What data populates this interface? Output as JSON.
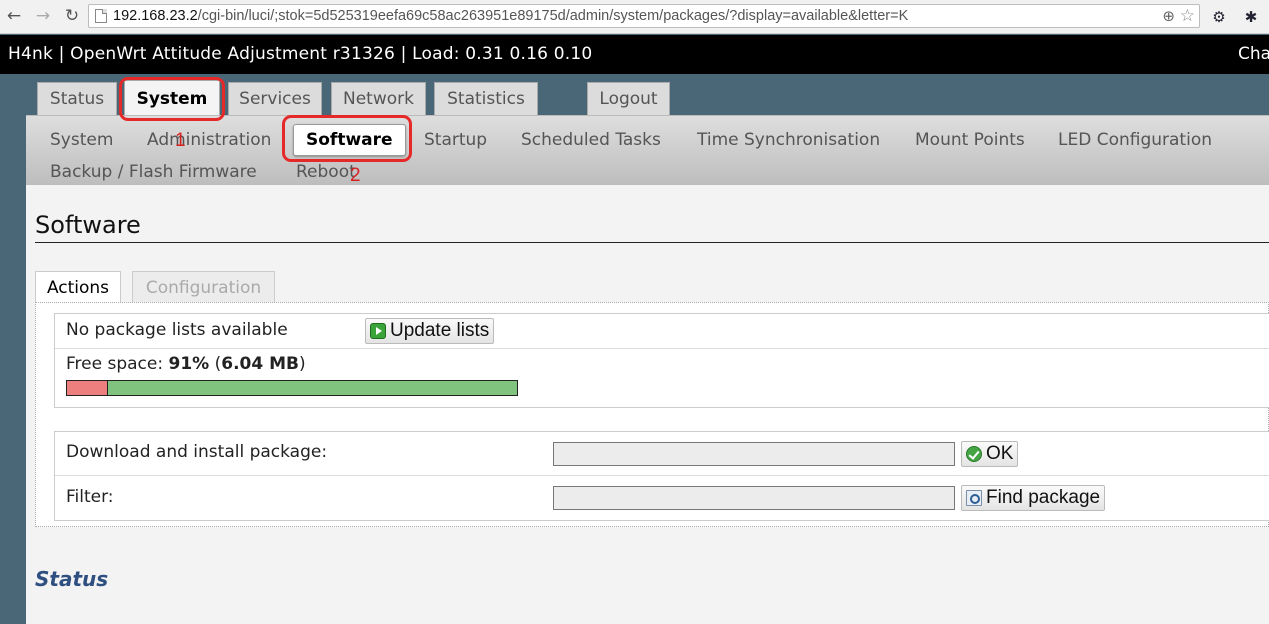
{
  "browser": {
    "url_host": "192.168.23.2",
    "url_path": "/cgi-bin/luci/;stok=5d525319eefa69c58ac263951e89175d/admin/system/packages/?display=available&letter=K"
  },
  "header": {
    "title": "H4nk | OpenWrt Attitude Adjustment r31326 | Load: 0.31 0.16 0.10",
    "right_text": "Cha"
  },
  "main_tabs": [
    "Status",
    "System",
    "Services",
    "Network",
    "Statistics",
    "Logout"
  ],
  "sub_nav": [
    "System",
    "Administration",
    "Software",
    "Startup",
    "Scheduled Tasks",
    "Time Synchronisation",
    "Mount Points",
    "LED Configuration",
    "Backup / Flash Firmware",
    "Reboot"
  ],
  "page": {
    "title": "Software",
    "tabs": [
      "Actions",
      "Configuration"
    ]
  },
  "actions": {
    "no_lists": "No package lists available",
    "update_button": "Update lists",
    "free_space_label": "Free space: ",
    "free_space_percent": "91%",
    "free_space_open": " (",
    "free_space_size": "6.04 MB",
    "free_space_close": ")",
    "used_fraction": 0.09,
    "download_label": "Download and install package:",
    "ok_button": "OK",
    "filter_label": "Filter:",
    "find_button": "Find package"
  },
  "status_section": {
    "title": "Status"
  },
  "annotations": [
    "1",
    "2"
  ]
}
